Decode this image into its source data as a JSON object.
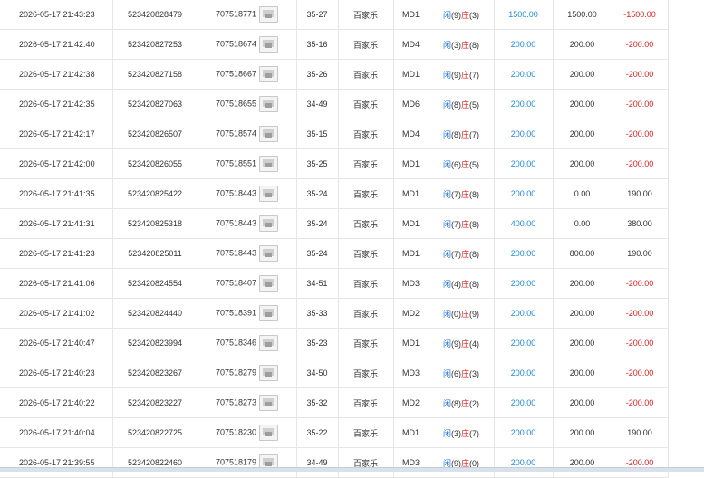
{
  "rows": [
    {
      "time": "2026-05-17 21:43:23",
      "bet_id": "523420828479",
      "round_id": "707518771",
      "shoe": "35-27",
      "game": "百家乐",
      "table": "MD1",
      "p": "9",
      "b": "3",
      "bet": "1500.00",
      "valid": "1500.00",
      "win": "-1500.00",
      "win_type": "neg"
    },
    {
      "time": "2026-05-17 21:42:40",
      "bet_id": "523420827253",
      "round_id": "707518674",
      "shoe": "35-16",
      "game": "百家乐",
      "table": "MD4",
      "p": "3",
      "b": "8",
      "bet": "200.00",
      "valid": "200.00",
      "win": "-200.00",
      "win_type": "neg"
    },
    {
      "time": "2026-05-17 21:42:38",
      "bet_id": "523420827158",
      "round_id": "707518667",
      "shoe": "35-26",
      "game": "百家乐",
      "table": "MD1",
      "p": "9",
      "b": "7",
      "bet": "200.00",
      "valid": "200.00",
      "win": "-200.00",
      "win_type": "neg"
    },
    {
      "time": "2026-05-17 21:42:35",
      "bet_id": "523420827063",
      "round_id": "707518655",
      "shoe": "34-49",
      "game": "百家乐",
      "table": "MD6",
      "p": "8",
      "b": "5",
      "bet": "200.00",
      "valid": "200.00",
      "win": "-200.00",
      "win_type": "neg"
    },
    {
      "time": "2026-05-17 21:42:17",
      "bet_id": "523420826507",
      "round_id": "707518574",
      "shoe": "35-15",
      "game": "百家乐",
      "table": "MD4",
      "p": "8",
      "b": "7",
      "bet": "200.00",
      "valid": "200.00",
      "win": "-200.00",
      "win_type": "neg"
    },
    {
      "time": "2026-05-17 21:42:00",
      "bet_id": "523420826055",
      "round_id": "707518551",
      "shoe": "35-25",
      "game": "百家乐",
      "table": "MD1",
      "p": "6",
      "b": "5",
      "bet": "200.00",
      "valid": "200.00",
      "win": "-200.00",
      "win_type": "neg"
    },
    {
      "time": "2026-05-17 21:41:35",
      "bet_id": "523420825422",
      "round_id": "707518443",
      "shoe": "35-24",
      "game": "百家乐",
      "table": "MD1",
      "p": "7",
      "b": "8",
      "bet": "200.00",
      "valid": "0.00",
      "win": "190.00",
      "win_type": "pos"
    },
    {
      "time": "2026-05-17 21:41:31",
      "bet_id": "523420825318",
      "round_id": "707518443",
      "shoe": "35-24",
      "game": "百家乐",
      "table": "MD1",
      "p": "7",
      "b": "8",
      "bet": "400.00",
      "valid": "0.00",
      "win": "380.00",
      "win_type": "pos"
    },
    {
      "time": "2026-05-17 21:41:23",
      "bet_id": "523420825011",
      "round_id": "707518443",
      "shoe": "35-24",
      "game": "百家乐",
      "table": "MD1",
      "p": "7",
      "b": "8",
      "bet": "200.00",
      "valid": "800.00",
      "win": "190.00",
      "win_type": "pos"
    },
    {
      "time": "2026-05-17 21:41:06",
      "bet_id": "523420824554",
      "round_id": "707518407",
      "shoe": "34-51",
      "game": "百家乐",
      "table": "MD3",
      "p": "4",
      "b": "8",
      "bet": "200.00",
      "valid": "200.00",
      "win": "-200.00",
      "win_type": "neg"
    },
    {
      "time": "2026-05-17 21:41:02",
      "bet_id": "523420824440",
      "round_id": "707518391",
      "shoe": "35-33",
      "game": "百家乐",
      "table": "MD2",
      "p": "0",
      "b": "9",
      "bet": "200.00",
      "valid": "200.00",
      "win": "-200.00",
      "win_type": "neg"
    },
    {
      "time": "2026-05-17 21:40:47",
      "bet_id": "523420823994",
      "round_id": "707518346",
      "shoe": "35-23",
      "game": "百家乐",
      "table": "MD1",
      "p": "9",
      "b": "4",
      "bet": "200.00",
      "valid": "200.00",
      "win": "-200.00",
      "win_type": "neg"
    },
    {
      "time": "2026-05-17 21:40:23",
      "bet_id": "523420823267",
      "round_id": "707518279",
      "shoe": "34-50",
      "game": "百家乐",
      "table": "MD3",
      "p": "6",
      "b": "3",
      "bet": "200.00",
      "valid": "200.00",
      "win": "-200.00",
      "win_type": "neg"
    },
    {
      "time": "2026-05-17 21:40:22",
      "bet_id": "523420823227",
      "round_id": "707518273",
      "shoe": "35-32",
      "game": "百家乐",
      "table": "MD2",
      "p": "8",
      "b": "2",
      "bet": "200.00",
      "valid": "200.00",
      "win": "-200.00",
      "win_type": "neg"
    },
    {
      "time": "2026-05-17 21:40:04",
      "bet_id": "523420822725",
      "round_id": "707518230",
      "shoe": "35-22",
      "game": "百家乐",
      "table": "MD1",
      "p": "3",
      "b": "7",
      "bet": "200.00",
      "valid": "200.00",
      "win": "190.00",
      "win_type": "pos"
    },
    {
      "time": "2026-05-17 21:39:55",
      "bet_id": "523420822460",
      "round_id": "707518179",
      "shoe": "34-49",
      "game": "百家乐",
      "table": "MD3",
      "p": "9",
      "b": "0",
      "bet": "200.00",
      "valid": "200.00",
      "win": "-200.00",
      "win_type": "neg"
    }
  ],
  "labels": {
    "player": "闲",
    "banker": "庄"
  },
  "colors": {
    "blue": "#1e88e5",
    "red": "#e02020",
    "border": "#e6e6e6"
  },
  "icons": {
    "result_thumbnail": "card-result-thumbnail-icon"
  }
}
